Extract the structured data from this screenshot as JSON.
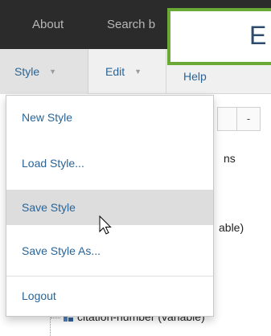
{
  "topbar": {
    "about": "About",
    "search": "Search b"
  },
  "title_box": {
    "text": "E"
  },
  "menubar": {
    "style": "Style",
    "edit": "Edit",
    "help": "Help"
  },
  "toolbar": {
    "btn1": "",
    "btn2": "-"
  },
  "background": {
    "ns_fragment": "ns",
    "able_fragment": "able)",
    "citation": "citation-number (variable)"
  },
  "dropdown": {
    "items": [
      {
        "label": "New Style"
      },
      {
        "label": "Load Style..."
      },
      {
        "label": "Save Style"
      },
      {
        "label": "Save Style As..."
      },
      {
        "label": "Logout"
      }
    ]
  },
  "colors": {
    "navbar_bg": "#2b2b2b",
    "link": "#2a6496",
    "title_border": "#6aa936",
    "active_item_bg": "#dddddd"
  },
  "icons": {
    "caret": "caret-down-icon",
    "tree": "variable-tree-icon",
    "cursor": "mouse-pointer-icon"
  }
}
